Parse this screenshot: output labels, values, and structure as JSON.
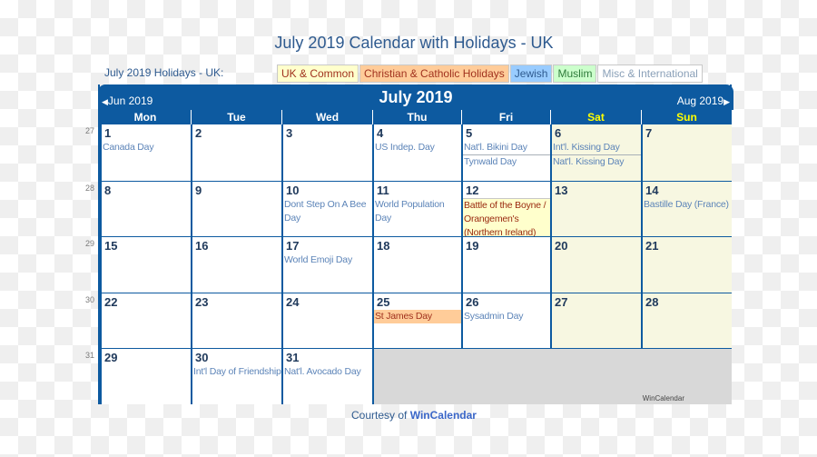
{
  "page": {
    "title": "July 2019 Calendar with Holidays - UK",
    "holidays_label": "July 2019 Holidays - UK:"
  },
  "legend": [
    {
      "label": "UK & Common",
      "color": "#ffffcc"
    },
    {
      "label": "Christian & Catholic Holidays",
      "color": "#ffcc99"
    },
    {
      "label": "Jewish",
      "color": "#99ccff"
    },
    {
      "label": "Muslim",
      "color": "#ccffcc"
    },
    {
      "label": "Misc & International",
      "color": "#ffffff"
    }
  ],
  "calendar": {
    "month_title": "July 2019",
    "prev_label": "Jun 2019",
    "next_label": "Aug 2019",
    "prev_icon": "triangle-left",
    "next_icon": "triangle-right",
    "header_color": "#0d5aa0",
    "weekend_header_color": "#ffff00",
    "days_of_week": [
      "Mon",
      "Tue",
      "Wed",
      "Thu",
      "Fri",
      "Sat",
      "Sun"
    ],
    "weeks": [
      {
        "week_number": "27",
        "days": [
          {
            "day": "1",
            "events": [
              {
                "text": "Canada Day",
                "type": "misc"
              }
            ]
          },
          {
            "day": "2",
            "events": []
          },
          {
            "day": "3",
            "events": []
          },
          {
            "day": "4",
            "events": [
              {
                "text": "US Indep. Day",
                "type": "misc"
              }
            ]
          },
          {
            "day": "5",
            "events": [
              {
                "text": "Nat'l. Bikini Day",
                "type": "misc"
              },
              {
                "text": "Tynwald Day",
                "type": "misc"
              }
            ]
          },
          {
            "day": "6",
            "events": [
              {
                "text": "Int'l. Kissing Day",
                "type": "misc"
              },
              {
                "text": "Nat'l. Kissing Day",
                "type": "misc"
              }
            ]
          },
          {
            "day": "7",
            "events": []
          }
        ]
      },
      {
        "week_number": "28",
        "days": [
          {
            "day": "8",
            "events": []
          },
          {
            "day": "9",
            "events": []
          },
          {
            "day": "10",
            "events": [
              {
                "text": "Dont Step On A Bee Day",
                "type": "misc"
              }
            ]
          },
          {
            "day": "11",
            "events": [
              {
                "text": "World Population Day",
                "type": "misc"
              }
            ]
          },
          {
            "day": "12",
            "events": [
              {
                "text": "Battle of the Boyne / Orangemen's (Northern Ireland)",
                "type": "uk"
              }
            ]
          },
          {
            "day": "13",
            "events": []
          },
          {
            "day": "14",
            "events": [
              {
                "text": "Bastille Day (France)",
                "type": "misc"
              }
            ]
          }
        ]
      },
      {
        "week_number": "29",
        "days": [
          {
            "day": "15",
            "events": []
          },
          {
            "day": "16",
            "events": []
          },
          {
            "day": "17",
            "events": [
              {
                "text": "World Emoji Day",
                "type": "misc"
              }
            ]
          },
          {
            "day": "18",
            "events": []
          },
          {
            "day": "19",
            "events": []
          },
          {
            "day": "20",
            "events": []
          },
          {
            "day": "21",
            "events": []
          }
        ]
      },
      {
        "week_number": "30",
        "days": [
          {
            "day": "22",
            "events": []
          },
          {
            "day": "23",
            "events": []
          },
          {
            "day": "24",
            "events": []
          },
          {
            "day": "25",
            "events": [
              {
                "text": "St James Day",
                "type": "christian"
              }
            ]
          },
          {
            "day": "26",
            "events": [
              {
                "text": "Sysadmin Day",
                "type": "misc"
              }
            ]
          },
          {
            "day": "27",
            "events": []
          },
          {
            "day": "28",
            "events": []
          }
        ]
      },
      {
        "week_number": "31",
        "days": [
          {
            "day": "29",
            "events": []
          },
          {
            "day": "30",
            "events": [
              {
                "text": "Int'l Day of Friendship",
                "type": "misc"
              }
            ]
          },
          {
            "day": "31",
            "events": [
              {
                "text": "Nat'l. Avocado Day",
                "type": "misc"
              }
            ]
          }
        ],
        "trailing_watermark": "WinCalendar"
      }
    ]
  },
  "footer": {
    "prefix": "Courtesy of",
    "link": "WinCalendar"
  }
}
